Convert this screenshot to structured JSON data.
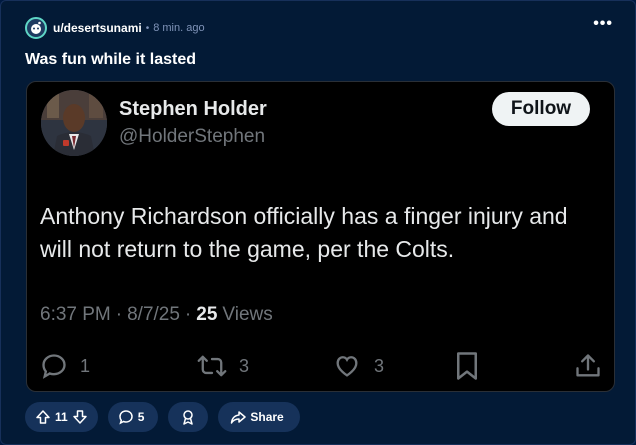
{
  "post": {
    "username": "u/desertsunami",
    "separator": "•",
    "timestamp": "8 min. ago",
    "more_label": "•••",
    "title": "Was fun while it lasted"
  },
  "tweet": {
    "name": "Stephen Holder",
    "handle": "@HolderStephen",
    "follow_label": "Follow",
    "text": "Anthony Richardson officially has a finger injury and will not return to the game, per the Colts.",
    "time": "6:37 PM",
    "date": "8/7/25",
    "meta_sep": "·",
    "views_count": "25",
    "views_label": "Views",
    "replies": "1",
    "retweets": "3",
    "likes": "3"
  },
  "footer": {
    "upvotes": "11",
    "comments": "5",
    "share_label": "Share"
  },
  "colors": {
    "page_bg": "#031a36",
    "pill_bg": "#16325a",
    "tweet_bg": "#000000",
    "tweet_muted": "#71767b",
    "avatar_ring": "#5fd6c6"
  },
  "icons": [
    "snoo-avatar-icon",
    "more-icon",
    "reply-icon",
    "retweet-icon",
    "like-icon",
    "bookmark-icon",
    "share-icon",
    "upvote-icon",
    "downvote-icon",
    "comment-icon",
    "award-icon",
    "share-arrow-icon"
  ]
}
